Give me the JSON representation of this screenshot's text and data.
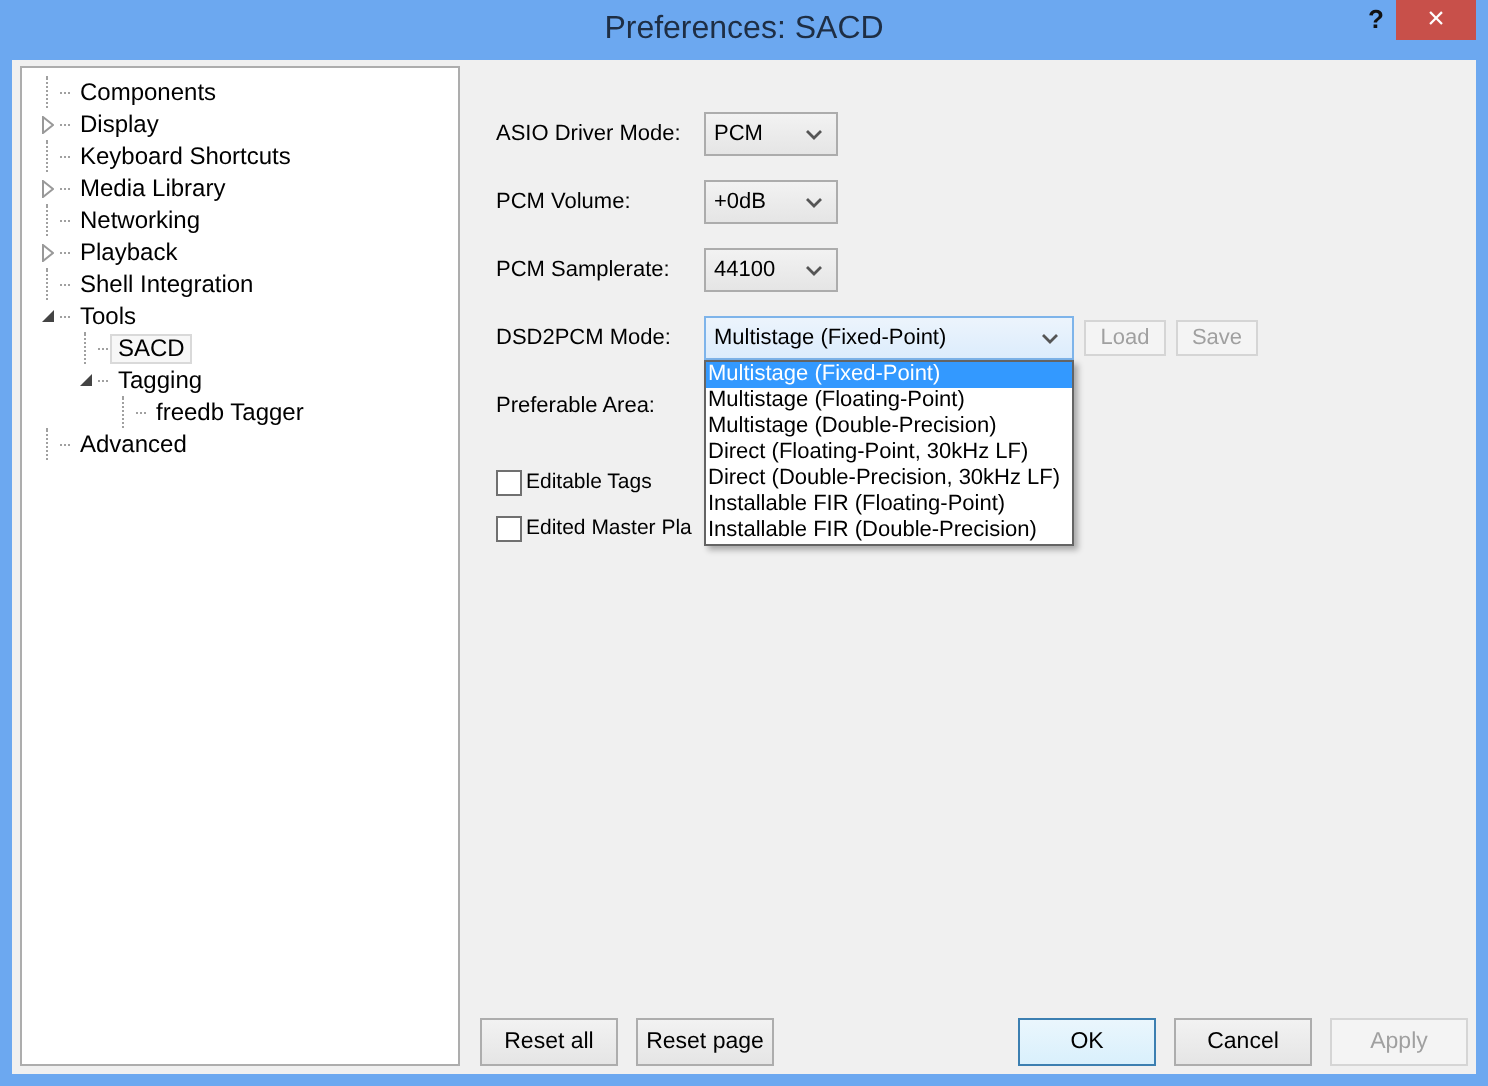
{
  "window": {
    "title": "Preferences: SACD",
    "help": "?",
    "close": "×"
  },
  "tree": [
    {
      "label": "Components",
      "selected": false
    },
    {
      "label": "Display",
      "expanded": false,
      "selected": false
    },
    {
      "label": "Keyboard Shortcuts",
      "selected": false
    },
    {
      "label": "Media Library",
      "expanded": false,
      "selected": false
    },
    {
      "label": "Networking",
      "selected": false
    },
    {
      "label": "Playback",
      "expanded": false,
      "selected": false
    },
    {
      "label": "Shell Integration",
      "selected": false
    },
    {
      "label": "Tools",
      "expanded": true,
      "selected": false,
      "children": [
        {
          "label": "SACD",
          "selected": true
        },
        {
          "label": "Tagging",
          "expanded": true,
          "selected": false,
          "children": [
            {
              "label": "freedb Tagger",
              "selected": false
            }
          ]
        }
      ]
    },
    {
      "label": "Advanced",
      "selected": false
    }
  ],
  "settings": [
    {
      "kind": "combo",
      "label": "ASIO Driver Mode:",
      "value": "PCM"
    },
    {
      "kind": "combo",
      "label": "PCM Volume:",
      "value": "+0dB"
    },
    {
      "kind": "combo",
      "label": "PCM Samplerate:",
      "value": "44100"
    },
    {
      "kind": "dropdown",
      "label": "DSD2PCM Mode:",
      "value": "Multistage (Fixed-Point)",
      "buttons": [
        {
          "label": "Load",
          "disabled": true
        },
        {
          "label": "Save",
          "disabled": true
        }
      ],
      "options": [
        {
          "label": "Multistage (Fixed-Point)",
          "selected": true
        },
        {
          "label": "Multistage (Floating-Point)",
          "selected": false
        },
        {
          "label": "Multistage (Double-Precision)",
          "selected": false
        },
        {
          "label": "Direct (Floating-Point, 30kHz LF)",
          "selected": false
        },
        {
          "label": "Direct (Double-Precision, 30kHz LF)",
          "selected": false
        },
        {
          "label": "Installable FIR (Floating-Point)",
          "selected": false
        },
        {
          "label": "Installable FIR (Double-Precision)",
          "selected": false
        }
      ]
    },
    {
      "kind": "label",
      "label": "Preferable Area:"
    },
    {
      "kind": "checkbox",
      "label": "Editable Tags",
      "checked": false
    },
    {
      "kind": "checkbox",
      "label": "Edited Master Pla",
      "checked": false
    }
  ],
  "footer": {
    "left": [
      {
        "label": "Reset all",
        "disabled": false
      },
      {
        "label": "Reset page",
        "disabled": false
      }
    ],
    "right": [
      {
        "label": "OK",
        "disabled": false,
        "default": true
      },
      {
        "label": "Cancel",
        "disabled": false,
        "default": false
      },
      {
        "label": "Apply",
        "disabled": true,
        "default": false
      }
    ]
  }
}
